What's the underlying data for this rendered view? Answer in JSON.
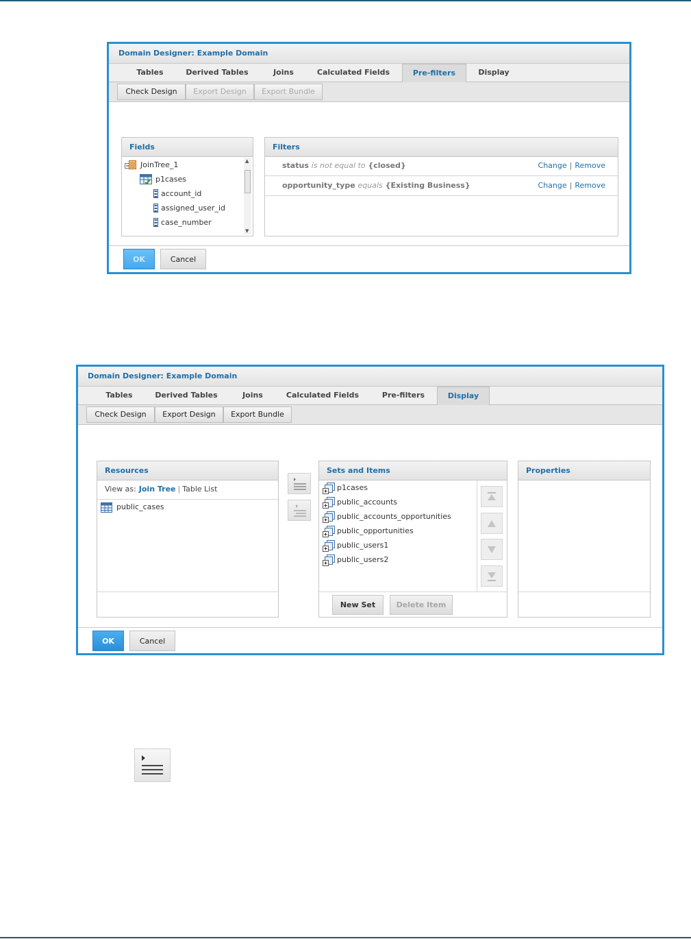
{
  "dialog1": {
    "title": "Domain Designer: Example Domain",
    "tabs": [
      "Tables",
      "Derived Tables",
      "Joins",
      "Calculated Fields",
      "Pre-filters",
      "Display"
    ],
    "active_tab": "Pre-filters",
    "toolbar": [
      "Check Design",
      "Export Design",
      "Export Bundle"
    ],
    "fields_panel": {
      "title": "Fields",
      "tree": [
        {
          "label": "JoinTree_1",
          "icon": "join-tree-icon"
        },
        {
          "label": "p1cases",
          "icon": "table-icon"
        },
        {
          "label": "account_id",
          "icon": "field-icon"
        },
        {
          "label": "assigned_user_id",
          "icon": "field-icon"
        },
        {
          "label": "case_number",
          "icon": "field-icon"
        }
      ]
    },
    "filters_panel": {
      "title": "Filters",
      "rows": [
        {
          "field": "status",
          "op": "is not equal to",
          "value": "{closed}",
          "change": "Change",
          "remove": "Remove"
        },
        {
          "field": "opportunity_type",
          "op": "equals",
          "value": "{Existing Business}",
          "change": "Change",
          "remove": "Remove"
        }
      ]
    },
    "ok_label": "OK",
    "cancel_label": "Cancel"
  },
  "dialog2": {
    "title": "Domain Designer: Example Domain",
    "tabs": [
      "Tables",
      "Derived Tables",
      "Joins",
      "Calculated Fields",
      "Pre-filters",
      "Display"
    ],
    "active_tab": "Display",
    "toolbar": [
      "Check Design",
      "Export Design",
      "Export Bundle"
    ],
    "resources_panel": {
      "title": "Resources",
      "view_as_label": "View as:",
      "join_tree_label": "Join Tree",
      "table_list_label": "Table List",
      "items": [
        "public_cases"
      ]
    },
    "sets_panel": {
      "title": "Sets and Items",
      "items": [
        "p1cases",
        "public_accounts",
        "public_accounts_opportunities",
        "public_opportunities",
        "public_users1",
        "public_users2"
      ],
      "new_set_label": "New Set",
      "delete_item_label": "Delete Item"
    },
    "properties_panel": {
      "title": "Properties"
    },
    "ok_label": "OK",
    "cancel_label": "Cancel"
  },
  "colors": {
    "accent": "#1f6fa8",
    "dialog_border": "#2a8fd0",
    "ok_button": "#2a8fd8"
  }
}
